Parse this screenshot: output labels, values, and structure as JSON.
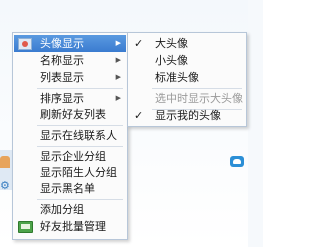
{
  "menu_left": {
    "items": [
      {
        "label": "头像显示",
        "has_submenu": true,
        "highlighted": true,
        "icon": "avatar-display-icon"
      },
      {
        "label": "名称显示",
        "has_submenu": true
      },
      {
        "label": "列表显示",
        "has_submenu": true
      },
      {
        "label": "排序显示",
        "has_submenu": true
      },
      {
        "label": "刷新好友列表"
      },
      {
        "label": "显示在线联系人"
      },
      {
        "label": "显示企业分组"
      },
      {
        "label": "显示陌生人分组"
      },
      {
        "label": "显示黑名单"
      },
      {
        "label": "添加分组"
      },
      {
        "label": "好友批量管理",
        "icon": "batch-manage-icon"
      }
    ],
    "submenu_arrow": "▶"
  },
  "menu_right": {
    "items": [
      {
        "label": "大头像",
        "checked": true
      },
      {
        "label": "小头像"
      },
      {
        "label": "标准头像"
      },
      {
        "label": "选中时显示大头像",
        "disabled": true
      },
      {
        "label": "显示我的头像",
        "checked": true
      }
    ],
    "check_glyph": "✓"
  },
  "background": {
    "gear_glyph": "⚙"
  }
}
